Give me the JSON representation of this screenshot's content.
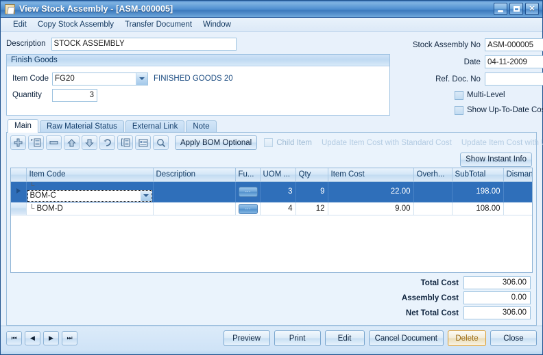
{
  "window": {
    "title": "View Stock Assembly  - [ASM-000005]",
    "icon": "document-icon",
    "buttons": {
      "minimize": "minimize-icon",
      "maximize": "maximize-icon",
      "close": "close-icon"
    }
  },
  "menubar": {
    "items": [
      {
        "label": "Edit"
      },
      {
        "label": "Copy Stock Assembly"
      },
      {
        "label": "Transfer Document"
      },
      {
        "label": "Window"
      }
    ]
  },
  "header": {
    "description_label": "Description",
    "description_value": "STOCK ASSEMBLY",
    "stock_assembly_no_label": "Stock Assembly No",
    "stock_assembly_no_value": "ASM-000005",
    "date_label": "Date",
    "date_value": "04-11-2009",
    "ref_doc_no_label": "Ref. Doc. No",
    "ref_doc_no_value": "",
    "multi_level_label": "Multi-Level",
    "multi_level_checked": false,
    "show_uptodate_label": "Show Up-To-Date Cost Details",
    "show_uptodate_checked": false
  },
  "finish_goods": {
    "group_title": "Finish Goods",
    "item_code_label": "Item Code",
    "item_code_value": "FG20",
    "item_description": "FINISHED GOODS 20",
    "quantity_label": "Quantity",
    "quantity_value": "3"
  },
  "tabs": [
    {
      "label": "Main",
      "active": true
    },
    {
      "label": "Raw Material Status",
      "active": false
    },
    {
      "label": "External Link",
      "active": false
    },
    {
      "label": "Note",
      "active": false
    }
  ],
  "grid_toolbar": {
    "icons": [
      {
        "name": "add-row-icon"
      },
      {
        "name": "insert-row-icon"
      },
      {
        "name": "delete-row-icon"
      },
      {
        "name": "move-up-icon"
      },
      {
        "name": "move-down-icon"
      },
      {
        "name": "undo-icon"
      },
      {
        "name": "expand-detail-icon"
      },
      {
        "name": "list-view-icon"
      },
      {
        "name": "search-icon"
      }
    ],
    "apply_bom_label": "Apply BOM Optional",
    "child_item_label": "Child Item",
    "child_item_checked": false,
    "update_standard_cost_label": "Update Item Cost with Standard Cost",
    "update_uptodate_cost_label": "Update Item Cost with Up-To-Date Cost",
    "show_instant_info_label": "Show Instant Info"
  },
  "grid": {
    "columns": [
      "Item Code",
      "Description",
      "Fu...",
      "UOM ...",
      "Qty",
      "Item Cost",
      "Overh...",
      "SubTotal",
      "Dismantle..."
    ],
    "rows": [
      {
        "selected": true,
        "editing": true,
        "item_code": "BOM-C",
        "description": "",
        "further": "...",
        "uom": "3",
        "qty": "9",
        "item_cost": "22.00",
        "overhead": "",
        "subtotal": "198.00",
        "dismantle": ""
      },
      {
        "selected": false,
        "editing": false,
        "item_code": "BOM-D",
        "description": "",
        "further": "...",
        "uom": "4",
        "qty": "12",
        "item_cost": "9.00",
        "overhead": "",
        "subtotal": "108.00",
        "dismantle": ""
      }
    ]
  },
  "totals": [
    {
      "label": "Total Cost",
      "value": "306.00"
    },
    {
      "label": "Assembly Cost",
      "value": "0.00"
    },
    {
      "label": "Net Total Cost",
      "value": "306.00"
    }
  ],
  "footer": {
    "nav": [
      {
        "name": "first-record-icon",
        "glyph": "⏮"
      },
      {
        "name": "previous-record-icon",
        "glyph": "◀"
      },
      {
        "name": "next-record-icon",
        "glyph": "▶"
      },
      {
        "name": "last-record-icon",
        "glyph": "⏭"
      }
    ],
    "buttons": [
      {
        "label": "Preview",
        "hover": false
      },
      {
        "label": "Print",
        "hover": false
      },
      {
        "label": "Edit",
        "hover": false
      },
      {
        "label": "Cancel Document",
        "hover": false
      },
      {
        "label": "Delete",
        "hover": true
      },
      {
        "label": "Close",
        "hover": false
      }
    ]
  },
  "colors": {
    "titlebar_start": "#4d88c8",
    "accent": "#2f6fba",
    "body_bg": "#e8f1fb",
    "hover_text": "#9a6a12"
  }
}
